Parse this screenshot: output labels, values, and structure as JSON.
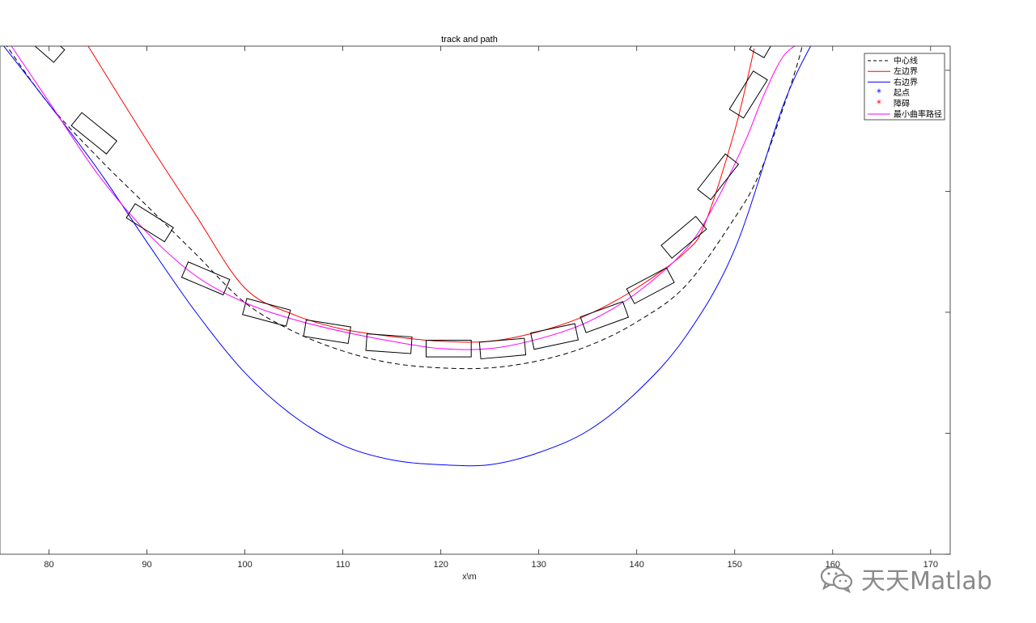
{
  "chart_data": {
    "type": "line",
    "title": "track and path",
    "xlabel": "x\\m",
    "ylabel": "",
    "xlim": [
      75,
      172
    ],
    "ylim": [
      -18,
      3
    ],
    "xticks": [
      80,
      90,
      100,
      110,
      120,
      130,
      140,
      150,
      160,
      170
    ],
    "grid": false,
    "legend_position": "top-right",
    "series": [
      {
        "name": "中心线",
        "color": "#000000",
        "style": "dashed",
        "x": [
          75,
          80,
          85,
          90,
          95,
          100,
          105,
          110,
          115,
          120,
          125,
          130,
          135,
          140,
          145,
          150,
          152.5,
          155,
          156.5,
          157
        ],
        "y": [
          3.4,
          0.6,
          -1.6,
          -3.6,
          -5.6,
          -7.6,
          -8.8,
          -9.6,
          -10.1,
          -10.3,
          -10.3,
          -10.0,
          -9.4,
          -8.4,
          -6.9,
          -4.1,
          -2.3,
          0.5,
          2.4,
          3.2
        ]
      },
      {
        "name": "左边界",
        "color": "#ff0000",
        "style": "solid",
        "x": [
          84,
          90,
          95,
          100,
          105,
          110,
          115,
          120,
          125,
          130,
          135,
          140,
          145,
          147,
          150,
          152
        ],
        "y": [
          3.0,
          -0.9,
          -4.0,
          -7.0,
          -8.1,
          -8.7,
          -9.0,
          -9.2,
          -9.2,
          -8.8,
          -8.1,
          -7.0,
          -5.5,
          -4.3,
          -0.5,
          2.9
        ]
      },
      {
        "name": "右边界",
        "color": "#0000ff",
        "style": "solid",
        "x": [
          75,
          80,
          85,
          90,
          95,
          100,
          105,
          110,
          115,
          120,
          125,
          130,
          135,
          140,
          145,
          150,
          155,
          158
        ],
        "y": [
          3.2,
          0.6,
          -2.1,
          -5.1,
          -8.0,
          -10.5,
          -12.3,
          -13.5,
          -14.1,
          -14.3,
          -14.3,
          -13.8,
          -12.9,
          -11.3,
          -9.0,
          -5.4,
          0.6,
          3.2
        ]
      },
      {
        "name": "最小曲率路径",
        "color": "#ff00ff",
        "style": "solid",
        "x": [
          76,
          80,
          85,
          90,
          95,
          100,
          105,
          110,
          115,
          120,
          125,
          130,
          135,
          140,
          145,
          148,
          151,
          153,
          155,
          157
        ],
        "y": [
          3.1,
          0.7,
          -2.3,
          -4.7,
          -6.5,
          -7.6,
          -8.3,
          -8.8,
          -9.2,
          -9.5,
          -9.5,
          -9.1,
          -8.4,
          -7.2,
          -5.4,
          -3.5,
          -1.0,
          1.0,
          2.6,
          3.2
        ]
      }
    ],
    "extra_series": [
      {
        "name": "起点",
        "color": "#0000ff",
        "marker": "*",
        "x": [],
        "y": []
      },
      {
        "name": "障碍",
        "color": "#ff0000",
        "marker": "*",
        "x": [],
        "y": []
      }
    ],
    "vehicles": {
      "color": "#000000",
      "length_m": 4.6,
      "width_m": 1.7,
      "poses": [
        {
          "x": 79.3,
          "y": 3.2,
          "angle_deg": -41
        },
        {
          "x": 84.6,
          "y": -0.6,
          "angle_deg": -39
        },
        {
          "x": 90.3,
          "y": -4.3,
          "angle_deg": -32
        },
        {
          "x": 96.0,
          "y": -6.6,
          "angle_deg": -23
        },
        {
          "x": 102.2,
          "y": -8.0,
          "angle_deg": -15
        },
        {
          "x": 108.4,
          "y": -8.8,
          "angle_deg": -9
        },
        {
          "x": 114.7,
          "y": -9.3,
          "angle_deg": -4
        },
        {
          "x": 120.8,
          "y": -9.5,
          "angle_deg": 0
        },
        {
          "x": 126.3,
          "y": -9.5,
          "angle_deg": 5
        },
        {
          "x": 131.6,
          "y": -9.0,
          "angle_deg": 12
        },
        {
          "x": 136.7,
          "y": -8.2,
          "angle_deg": 20
        },
        {
          "x": 141.4,
          "y": -6.9,
          "angle_deg": 28
        },
        {
          "x": 144.8,
          "y": -4.9,
          "angle_deg": 40
        },
        {
          "x": 148.3,
          "y": -2.4,
          "angle_deg": 52
        },
        {
          "x": 151.4,
          "y": 1.0,
          "angle_deg": 58
        },
        {
          "x": 153.4,
          "y": 3.5,
          "angle_deg": 60
        },
        {
          "x": 156.2,
          "y": 4.5,
          "angle_deg": 64
        }
      ]
    }
  },
  "watermark": {
    "text": "天天Matlab",
    "icon": "wechat-icon"
  }
}
